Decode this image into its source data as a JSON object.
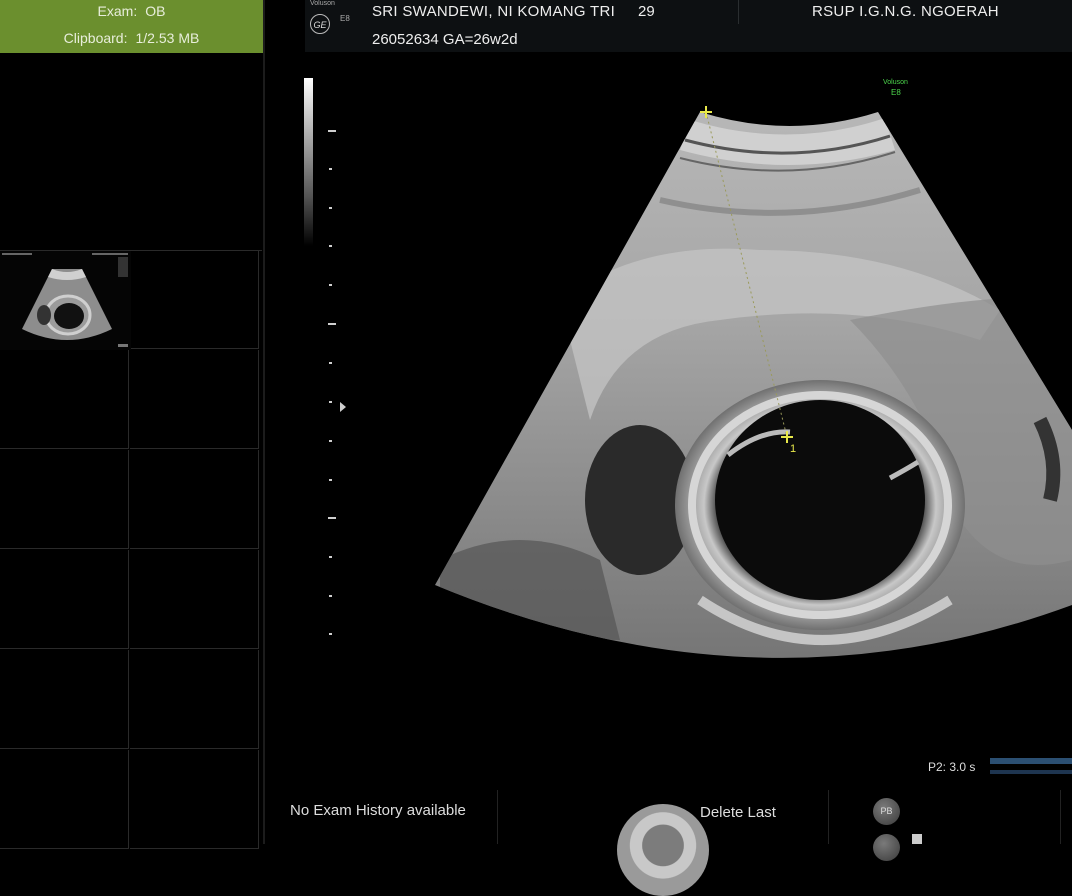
{
  "left_panel": {
    "exam_label": "Exam:",
    "exam_value": "OB",
    "clipboard_label": "Clipboard:",
    "clipboard_value": "1/2.53 MB"
  },
  "header": {
    "patient_name": "SRI SWANDEWI, NI KOMANG TRI",
    "patient_age": "29",
    "hospital": "RSUP I.G.N.G. NGOERAH",
    "patient_id_ga": "26052634   GA=26w2d",
    "brand_small": "Voluson",
    "brand_mark": "GE",
    "model": "E8"
  },
  "image": {
    "probe_brand": "Voluson",
    "probe_model": "E8",
    "caliper_number": "1"
  },
  "bottom": {
    "no_history": "No Exam History available",
    "delete_last": "Delete Last",
    "cine_label": "P2:  3.0 s",
    "button_label": "PB"
  },
  "colors": {
    "exam_panel": "#6b8f2e",
    "caliper": "#e8e84a",
    "probe_label": "#4cd64c"
  }
}
